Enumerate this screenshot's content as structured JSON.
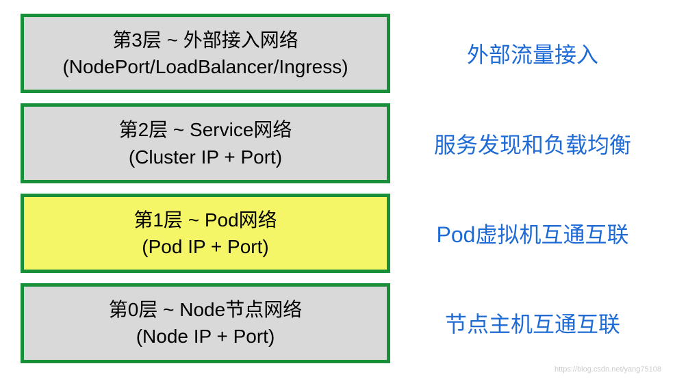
{
  "layers": [
    {
      "title": "第3层 ~ 外部接入网络",
      "subtitle": "(NodePort/LoadBalancer/Ingress)",
      "desc": "外部流量接入",
      "highlight": false
    },
    {
      "title": "第2层 ~ Service网络",
      "subtitle": "(Cluster IP + Port)",
      "desc": "服务发现和负载均衡",
      "highlight": false
    },
    {
      "title": "第1层 ~ Pod网络",
      "subtitle": "(Pod IP + Port)",
      "desc": "Pod虚拟机互通互联",
      "highlight": true
    },
    {
      "title": "第0层 ~ Node节点网络",
      "subtitle": "(Node IP + Port)",
      "desc": "节点主机互通互联",
      "highlight": false
    }
  ],
  "watermark": "https://blog.csdn.net/yang75108",
  "colors": {
    "border": "#1a8f3a",
    "bg_default": "#d9d9d9",
    "bg_highlight": "#f4f567",
    "desc_text": "#1f6bd6"
  }
}
